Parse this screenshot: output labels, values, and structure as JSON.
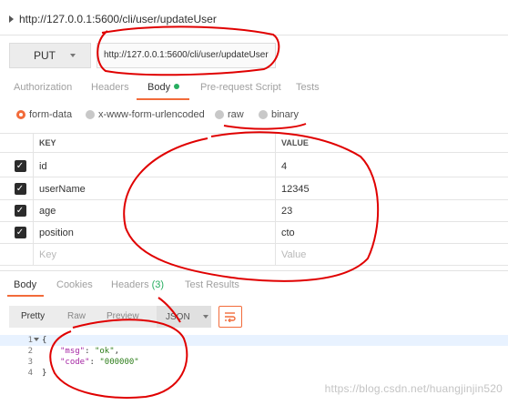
{
  "request": {
    "title": "http://127.0.0.1:5600/cli/user/updateUser",
    "method": "PUT",
    "url": "http://127.0.0.1:5600/cli/user/updateUser"
  },
  "request_tabs": {
    "authorization": "Authorization",
    "headers": "Headers",
    "body": "Body",
    "pre_request": "Pre-request Script",
    "tests": "Tests"
  },
  "body_types": {
    "form_data": "form-data",
    "urlencoded": "x-www-form-urlencoded",
    "raw": "raw",
    "binary": "binary",
    "selected": "form-data"
  },
  "params": {
    "key_header": "KEY",
    "value_header": "VALUE",
    "rows": [
      {
        "key": "id",
        "value": "4",
        "checked": true
      },
      {
        "key": "userName",
        "value": "12345",
        "checked": true
      },
      {
        "key": "age",
        "value": "23",
        "checked": true
      },
      {
        "key": "position",
        "value": "cto",
        "checked": true
      }
    ],
    "key_placeholder": "Key",
    "value_placeholder": "Value"
  },
  "response_tabs": {
    "body": "Body",
    "cookies": "Cookies",
    "headers": "Headers",
    "headers_count": "(3)",
    "test_results": "Test Results"
  },
  "view": {
    "pretty": "Pretty",
    "raw": "Raw",
    "preview": "Preview",
    "format": "JSON"
  },
  "code": {
    "line_numbers": [
      "1",
      "2",
      "3",
      "4"
    ],
    "l1": "{",
    "l2_key": "\"msg\"",
    "l2_sep": ": ",
    "l2_val": "\"ok\"",
    "l2_end": ",",
    "l3_key": "\"code\"",
    "l3_sep": ": ",
    "l3_val": "\"000000\"",
    "l4": "}"
  },
  "watermark": "https://blog.csdn.net/huangjinjin520",
  "colors": {
    "accent": "#f26b3a",
    "active_dot": "#27ae60",
    "annotation": "#e00000"
  }
}
